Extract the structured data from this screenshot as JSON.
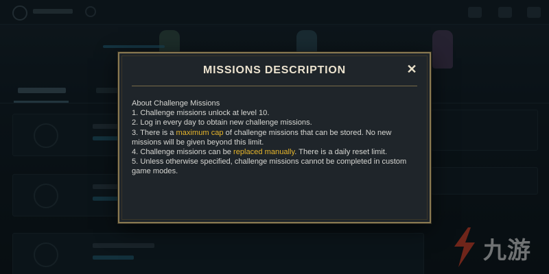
{
  "modal": {
    "title": "MISSIONS DESCRIPTION",
    "close_label": "✕",
    "section_heading": "About Challenge Missions",
    "items": [
      {
        "prefix": "1. Challenge missions unlock at level 10.",
        "highlight": "",
        "suffix": ""
      },
      {
        "prefix": "2. Log in every day to obtain new challenge missions.",
        "highlight": "",
        "suffix": ""
      },
      {
        "prefix": "3. There is a ",
        "highlight": "maximum cap",
        "suffix": " of challenge missions that can be stored. No new missions will be given beyond this limit."
      },
      {
        "prefix": "4. Challenge missions can be ",
        "highlight": "replaced manually",
        "suffix": ". There is a daily reset limit."
      },
      {
        "prefix": "5. Unless otherwise specified, challenge missions cannot be completed in custom game modes.",
        "highlight": "",
        "suffix": ""
      }
    ]
  },
  "watermark": {
    "text": "九游"
  },
  "colors": {
    "highlight": "#e6b52c",
    "modal_border": "#8a7a52",
    "modal_bg": "#1f252a",
    "title_text": "#ece3cf"
  }
}
